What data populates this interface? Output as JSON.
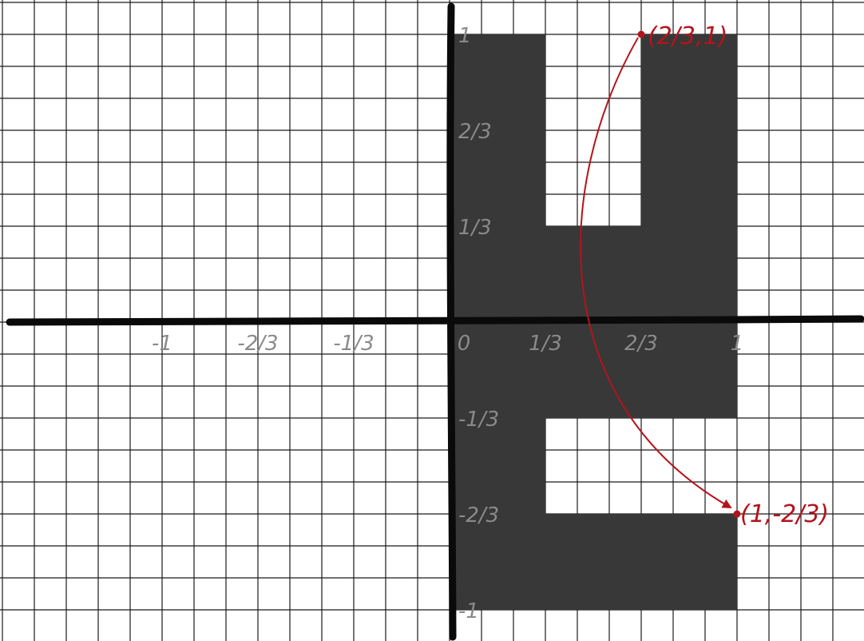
{
  "diagram": {
    "colors": {
      "grid": "#1a1a1a",
      "axis": "#0a0a0a",
      "shape": "#383838",
      "tick_label": "#8a8a8a",
      "annotation": "#b3141c"
    },
    "x_axis": {
      "ticks": [
        {
          "value": -1,
          "label": "-1"
        },
        {
          "value": -0.6667,
          "label": "-2/3"
        },
        {
          "value": -0.3333,
          "label": "-1/3"
        },
        {
          "value": 0,
          "label": "0"
        },
        {
          "value": 0.3333,
          "label": "1/3"
        },
        {
          "value": 0.6667,
          "label": "2/3"
        },
        {
          "value": 1,
          "label": "1"
        }
      ]
    },
    "y_axis": {
      "ticks": [
        {
          "value": 1,
          "label": "1"
        },
        {
          "value": 0.6667,
          "label": "2/3"
        },
        {
          "value": 0.3333,
          "label": "1/3"
        },
        {
          "value": -0.3333,
          "label": "-1/3"
        },
        {
          "value": -0.6667,
          "label": "-2/3"
        },
        {
          "value": -1,
          "label": "-1"
        }
      ]
    },
    "shaded_region": {
      "vertices": [
        [
          0,
          1
        ],
        [
          0.3333,
          1
        ],
        [
          0.3333,
          0.3333
        ],
        [
          0.6667,
          0.3333
        ],
        [
          0.6667,
          1
        ],
        [
          1,
          1
        ],
        [
          1,
          -0.3333
        ],
        [
          0.3333,
          -0.3333
        ],
        [
          0.3333,
          -0.6667
        ],
        [
          1,
          -0.6667
        ],
        [
          1,
          -1
        ],
        [
          0,
          -1
        ]
      ]
    },
    "points": [
      {
        "x": 0.6667,
        "y": 1,
        "label": "(2/3,1)"
      },
      {
        "x": 1,
        "y": -0.6667,
        "label": "(1,-2/3)"
      }
    ],
    "arrow": {
      "from_point": 0,
      "to_point": 1
    }
  }
}
